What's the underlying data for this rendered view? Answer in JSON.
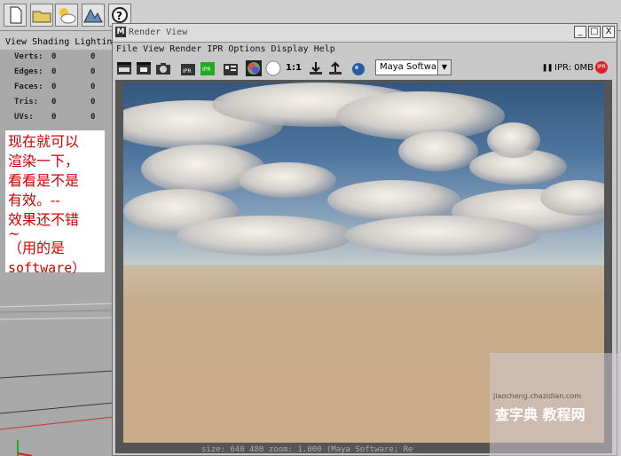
{
  "left_panel": {
    "menu": [
      "View",
      "Shading",
      "Lighting"
    ],
    "hud": [
      {
        "label": "Verts:",
        "v1": "0",
        "v2": "0"
      },
      {
        "label": "Edges:",
        "v1": "0",
        "v2": "0"
      },
      {
        "label": "Faces:",
        "v1": "0",
        "v2": "0"
      },
      {
        "label": "Tris:",
        "v1": "0",
        "v2": "0"
      },
      {
        "label": "UVs:",
        "v1": "0",
        "v2": "0"
      }
    ],
    "note_lines": [
      "现在就可以",
      "渲染一下，",
      "看看是不是",
      "有效。--",
      "效果还不错",
      "~",
      "（用的是",
      "software）"
    ]
  },
  "render_view": {
    "title": "Render View",
    "win_buttons": [
      "_",
      "□",
      "X"
    ],
    "menu": [
      "File",
      "View",
      "Render",
      "IPR",
      "Options",
      "Display",
      "Help"
    ],
    "toolbar": {
      "ratio_label": "1:1",
      "renderer": "Maya Software",
      "ipr_memory": "IPR: 0MB",
      "ipr_badge": "IPR"
    },
    "status_bar": "size:  640  480 zoom: 1.000        (Maya Software; Re"
  },
  "watermark": {
    "site": "查字典 教程网",
    "url": "jiaocheng.chazidian.com"
  }
}
